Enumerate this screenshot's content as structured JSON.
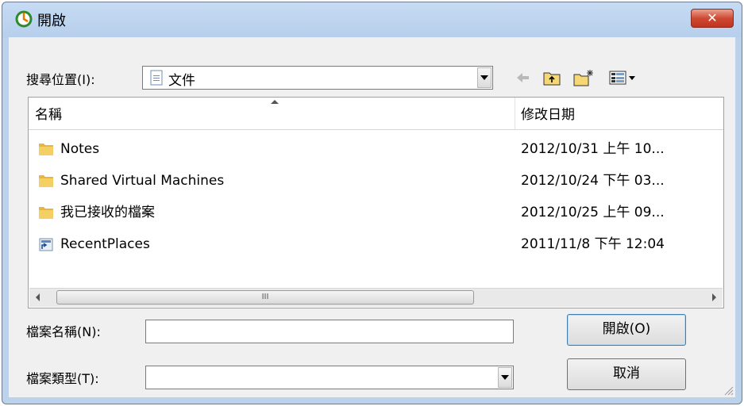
{
  "window": {
    "title": "開啟",
    "close_symbol": "✕"
  },
  "toolbar": {
    "look_in_label": "搜尋位置(I):",
    "look_in_value": "文件",
    "back_icon": "back-arrow-icon",
    "up_icon": "up-folder-icon",
    "new_folder_icon": "new-folder-icon",
    "view_icon": "view-menu-icon"
  },
  "list": {
    "columns": [
      {
        "label": "名稱"
      },
      {
        "label": "修改日期"
      }
    ],
    "rows": [
      {
        "name": "Notes",
        "date": "2012/10/31 上午 10...",
        "icon": "folder-icon"
      },
      {
        "name": "Shared Virtual Machines",
        "date": "2012/10/24 下午 03...",
        "icon": "folder-icon"
      },
      {
        "name": "我已接收的檔案",
        "date": "2012/10/25 上午 09...",
        "icon": "folder-icon"
      },
      {
        "name": "RecentPlaces",
        "date": "2011/11/8 下午 12:04",
        "icon": "shortcut-icon"
      }
    ],
    "scroll_thumb_grip": "III"
  },
  "filename": {
    "label": "檔案名稱(N):",
    "value": ""
  },
  "filetype": {
    "label": "檔案類型(T):",
    "value": ""
  },
  "buttons": {
    "open": "開啟(O)",
    "cancel": "取消"
  },
  "colors": {
    "title_bg": "#bcd1ea",
    "close_red": "#c0341f",
    "folder_yellow": "#e8b540"
  }
}
